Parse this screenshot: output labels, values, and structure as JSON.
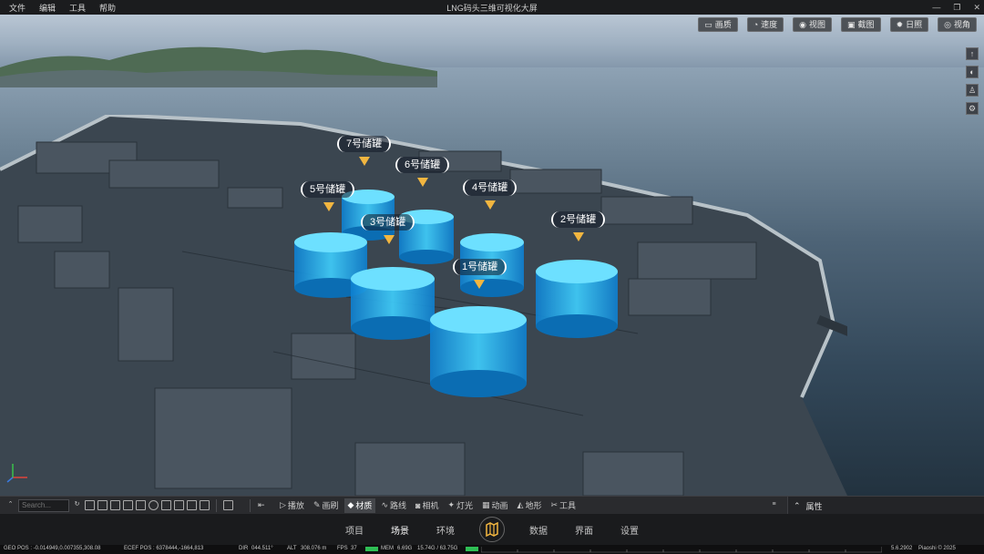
{
  "menu": [
    "文件",
    "编辑",
    "工具",
    "帮助"
  ],
  "window_title": "LNG码头三维可视化大屏",
  "window_controls": [
    "—",
    "❐",
    "✕"
  ],
  "top_buttons": [
    {
      "icon": "monitor-icon",
      "glyph": "▭",
      "label": "画质"
    },
    {
      "icon": "speed-icon",
      "glyph": "◔",
      "label": "速度"
    },
    {
      "icon": "view-icon",
      "glyph": "◉",
      "label": "视图"
    },
    {
      "icon": "screenshot-icon",
      "glyph": "▣",
      "label": "截图"
    },
    {
      "icon": "sun-icon",
      "glyph": "✹",
      "label": "日照"
    },
    {
      "icon": "eye-icon",
      "glyph": "◎",
      "label": "视角"
    }
  ],
  "side_buttons": [
    {
      "icon": "compass-icon",
      "glyph": "↑"
    },
    {
      "icon": "globe-icon",
      "glyph": "◐"
    },
    {
      "icon": "person-icon",
      "glyph": "♙"
    },
    {
      "icon": "gear-icon",
      "glyph": "⚙"
    }
  ],
  "tanks": [
    {
      "label": "7号储罐"
    },
    {
      "label": "6号储罐"
    },
    {
      "label": "5号储罐"
    },
    {
      "label": "4号储罐"
    },
    {
      "label": "3号储罐"
    },
    {
      "label": "2号储罐"
    },
    {
      "label": "1号储罐"
    }
  ],
  "toolbar": {
    "search_placeholder": "Search...",
    "tabs": [
      {
        "icon": "play-icon",
        "glyph": "▷",
        "label": "播放"
      },
      {
        "icon": "brush-icon",
        "glyph": "✎",
        "label": "画刷"
      },
      {
        "icon": "material-icon",
        "glyph": "◆",
        "label": "材质"
      },
      {
        "icon": "route-icon",
        "glyph": "∿",
        "label": "路线"
      },
      {
        "icon": "camera-icon",
        "glyph": "◙",
        "label": "相机"
      },
      {
        "icon": "light-icon",
        "glyph": "✦",
        "label": "灯光"
      },
      {
        "icon": "animation-icon",
        "glyph": "▦",
        "label": "动画"
      },
      {
        "icon": "terrain-icon",
        "glyph": "◭",
        "label": "地形"
      },
      {
        "icon": "tools-icon",
        "glyph": "✂",
        "label": "工具"
      }
    ],
    "properties_label": "属性"
  },
  "bottom_nav": [
    "项目",
    "场景",
    "环境",
    "数据",
    "界面",
    "设置"
  ],
  "status": {
    "geo": "GEO POS : -0.014949,0.007355,308.08",
    "ecef": "ECEF POS : 6378444,-1664,813",
    "dir_label": "DIR",
    "dir": "044.511°",
    "alt_label": "ALT",
    "alt": "308.076 m",
    "fps_label": "FPS",
    "fps": "37",
    "mem_label": "MEM",
    "mem": "6.69G",
    "mem_total": "15.74G / 63.75G",
    "version": "5.6.2902",
    "copyright": "Piaoshi © 2025"
  },
  "colors": {
    "accent": "#f2b640",
    "tank_glow": "#27b9ff"
  }
}
